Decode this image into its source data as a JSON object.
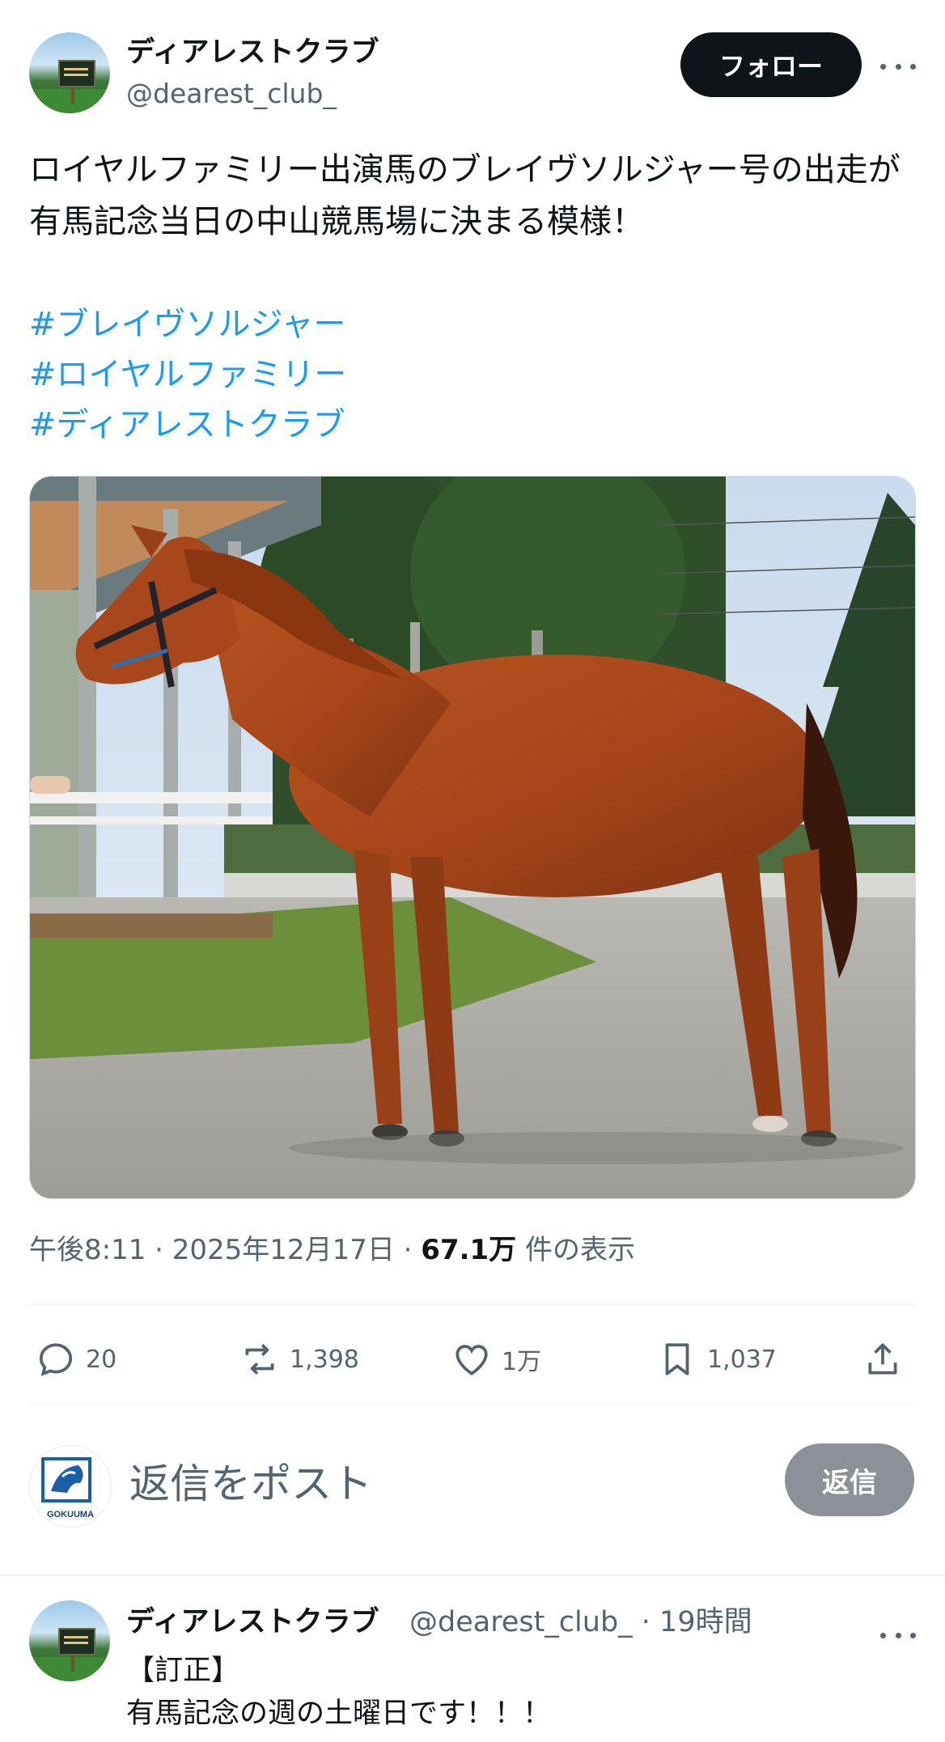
{
  "post": {
    "author": {
      "display_name": "ディアレストクラブ",
      "handle": "@dearest_club_"
    },
    "follow_label": "フォロー",
    "text": "ロイヤルファミリー出演馬のブレイヴソルジャー号の出走が有馬記念当日の中山競馬場に決まる模様！",
    "hashtags": [
      "#ブレイヴソルジャー",
      "#ロイヤルファミリー",
      "#ディアレストクラブ"
    ],
    "meta": {
      "time_date": "午後8:11 · 2025年12月17日 · ",
      "views_value": "67.1万",
      "views_label": " 件の表示"
    },
    "actions": {
      "replies": "20",
      "reposts": "1,398",
      "likes": "1万",
      "bookmarks": "1,037"
    },
    "icons": {
      "more": "more-icon",
      "reply": "reply-icon",
      "repost": "repost-icon",
      "like": "heart-icon",
      "bookmark": "bookmark-icon",
      "share": "share-icon"
    }
  },
  "reply_box": {
    "avatar_label": "GOKUUMA",
    "placeholder": "返信をポスト",
    "button_label": "返信"
  },
  "reply_tweet": {
    "display_name": "ディアレストクラブ",
    "meta": "@dearest_club_ · 19時間",
    "line1": "【訂正】",
    "line2": "有馬記念の週の土曜日です！！！"
  },
  "colors": {
    "link": "#1d9bf0",
    "text": "#0f1419",
    "muted": "#536471",
    "button_dark": "#0f1419",
    "button_disabled": "#8b9196"
  }
}
